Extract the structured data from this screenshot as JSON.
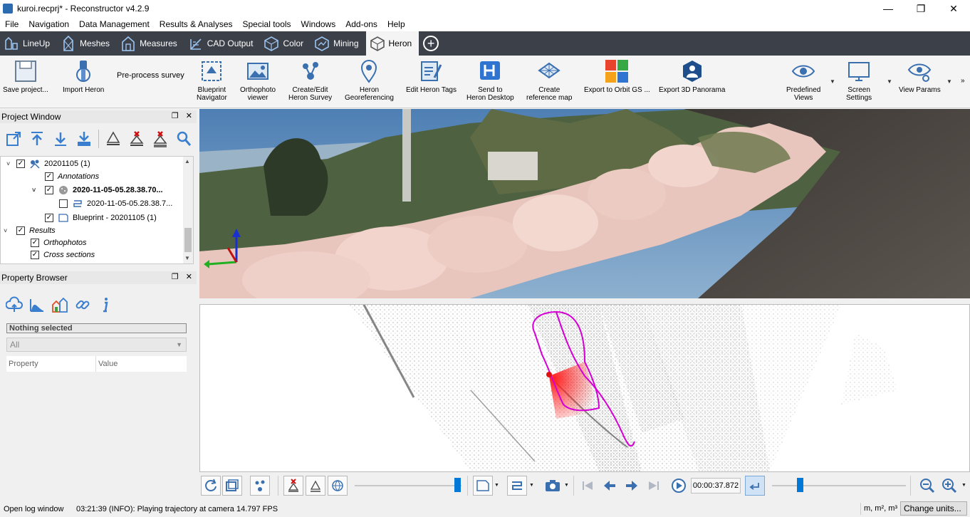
{
  "window": {
    "title": "kuroi.recprj* - Reconstructor v4.2.9",
    "min_glyph": "—",
    "max_glyph": "❐",
    "close_glyph": "✕"
  },
  "menu": [
    "File",
    "Navigation",
    "Data Management",
    "Results & Analyses",
    "Special tools",
    "Windows",
    "Add-ons",
    "Help"
  ],
  "tabs": [
    {
      "label": "LineUp",
      "icon": "lineup-icon"
    },
    {
      "label": "Meshes",
      "icon": "meshes-icon"
    },
    {
      "label": "Measures",
      "icon": "measures-icon"
    },
    {
      "label": "CAD Output",
      "icon": "cad-output-icon"
    },
    {
      "label": "Color",
      "icon": "color-icon"
    },
    {
      "label": "Mining",
      "icon": "mining-icon"
    },
    {
      "label": "Heron",
      "icon": "heron-icon",
      "active": true
    }
  ],
  "ribbon": {
    "save_project": "Save project...",
    "import_heron": "Import Heron",
    "preprocess": "Pre-process survey",
    "blueprint_navigator": "Blueprint\nNavigator",
    "orthophoto_viewer": "Orthophoto\nviewer",
    "create_edit_survey": "Create/Edit\nHeron Survey",
    "georeferencing": "Heron\nGeoreferencing",
    "edit_tags": "Edit Heron Tags",
    "send_desktop": "Send to\nHeron Desktop",
    "create_ref_map": "Create\nreference map",
    "export_orbit": "Export to Orbit GS ...",
    "export_panorama": "Export 3D Panorama",
    "predefined_views": "Predefined\nViews",
    "screen_settings": "Screen\nSettings",
    "view_params": "View Params",
    "overflow": "»"
  },
  "project_window": {
    "title": "Project Window",
    "tree": [
      {
        "label": "20201105 (1)",
        "style": "normal",
        "checked": true,
        "expanded": true
      },
      {
        "label": "Annotations",
        "style": "italic",
        "checked": true
      },
      {
        "label": "2020-11-05-05.28.38.70...",
        "style": "bold",
        "checked": true,
        "expanded": true
      },
      {
        "label": "2020-11-05-05.28.38.7...",
        "style": "normal",
        "checked": false
      },
      {
        "label": "Blueprint - 20201105 (1)",
        "style": "normal",
        "checked": true
      },
      {
        "label": "Results",
        "style": "italic",
        "checked": true,
        "expanded": true
      },
      {
        "label": "Orthophotos",
        "style": "italic",
        "checked": true
      },
      {
        "label": "Cross sections",
        "style": "italic",
        "checked": true
      }
    ]
  },
  "property_browser": {
    "title": "Property Browser",
    "selection": "Nothing selected",
    "filter": "All",
    "col_property": "Property",
    "col_value": "Value"
  },
  "player": {
    "time": "00:00:37.872"
  },
  "status": {
    "log": "Open log window",
    "message": "03:21:39 (INFO): Playing trajectory at camera 14.797 FPS",
    "units": "m, m², m³",
    "change_units": "Change units..."
  },
  "colors": {
    "tabbar": "#3c4049",
    "accent": "#0078d7",
    "trajectory": "#d400d4",
    "frustum": "#ff2020"
  }
}
